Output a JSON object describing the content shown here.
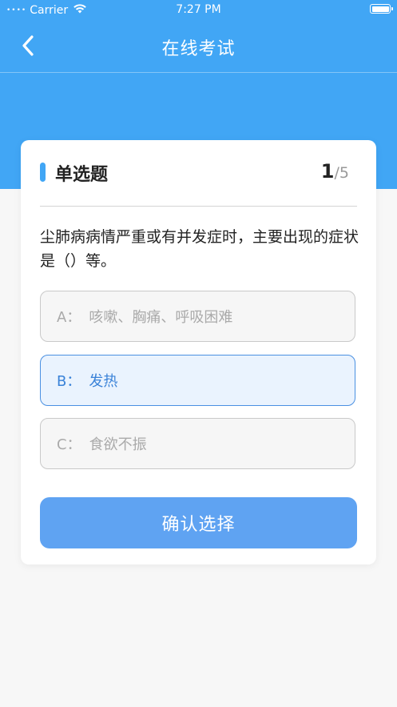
{
  "status_bar": {
    "carrier": "Carrier",
    "signal": "••••",
    "time": "7:27 PM"
  },
  "nav": {
    "title": "在线考试",
    "back_icon": "chevron-left-icon"
  },
  "question_card": {
    "type_label": "单选题",
    "current": "1",
    "separator": "/",
    "total": "5",
    "text": "尘肺病病情严重或有并发症时，主要出现的症状是（）等。",
    "options": [
      {
        "key": "A：",
        "text": "咳嗽、胸痛、呼吸困难",
        "selected": false
      },
      {
        "key": "B：",
        "text": "发热",
        "selected": true
      },
      {
        "key": "C：",
        "text": "食欲不振",
        "selected": false
      }
    ],
    "confirm_label": "确认选择"
  },
  "colors": {
    "primary": "#41a6f5",
    "button": "#5fa3f2",
    "selected_border": "#4a90e2",
    "selected_bg": "#eaf3fe",
    "selected_text": "#3a82d8"
  }
}
